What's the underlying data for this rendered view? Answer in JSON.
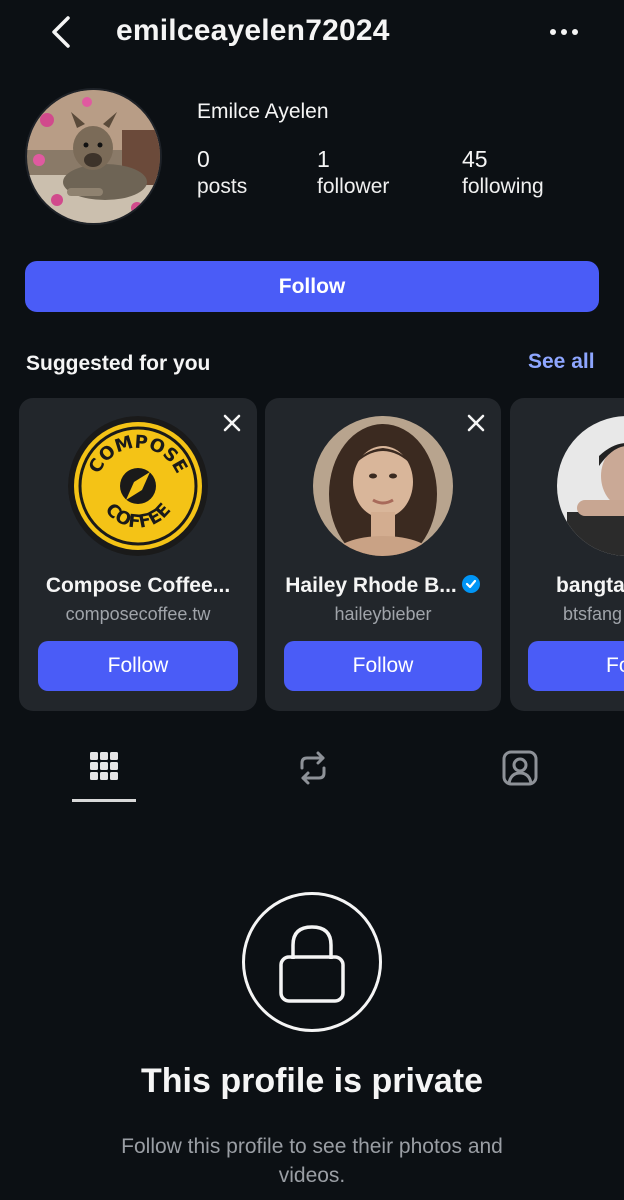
{
  "header": {
    "username": "emilceayelen72024",
    "back_icon": "chevron-left-icon",
    "more_icon": "more-horizontal-icon"
  },
  "profile": {
    "display_name": "Emilce Ayelen",
    "stats": [
      {
        "value": "0",
        "label": "posts"
      },
      {
        "value": "1",
        "label": "follower"
      },
      {
        "value": "45",
        "label": "following"
      }
    ],
    "follow_label": "Follow"
  },
  "suggested": {
    "title": "Suggested for you",
    "see_all": "See all",
    "cards": [
      {
        "name": "Compose Coffee...",
        "handle": "composecoffee.tw",
        "follow": "Follow",
        "verified": false,
        "logo_top": "COMPOSE",
        "logo_bottom": "COFFEE"
      },
      {
        "name": "Hailey Rhode B...",
        "handle": "haileybieber",
        "follow": "Follow",
        "verified": true
      },
      {
        "name": "bangta",
        "handle": "btsfang",
        "follow": "Fol",
        "verified": false
      }
    ]
  },
  "tabs": [
    {
      "icon": "grid-icon",
      "active": true
    },
    {
      "icon": "repost-icon",
      "active": false
    },
    {
      "icon": "tagged-person-icon",
      "active": false
    }
  ],
  "private": {
    "title": "This profile is private",
    "subtitle": "Follow this profile to see their photos and videos."
  },
  "colors": {
    "background": "#0c1014",
    "accent": "#4a5cf7",
    "link": "#8ea6ff",
    "card": "#22262b",
    "verified": "#0095f6"
  }
}
